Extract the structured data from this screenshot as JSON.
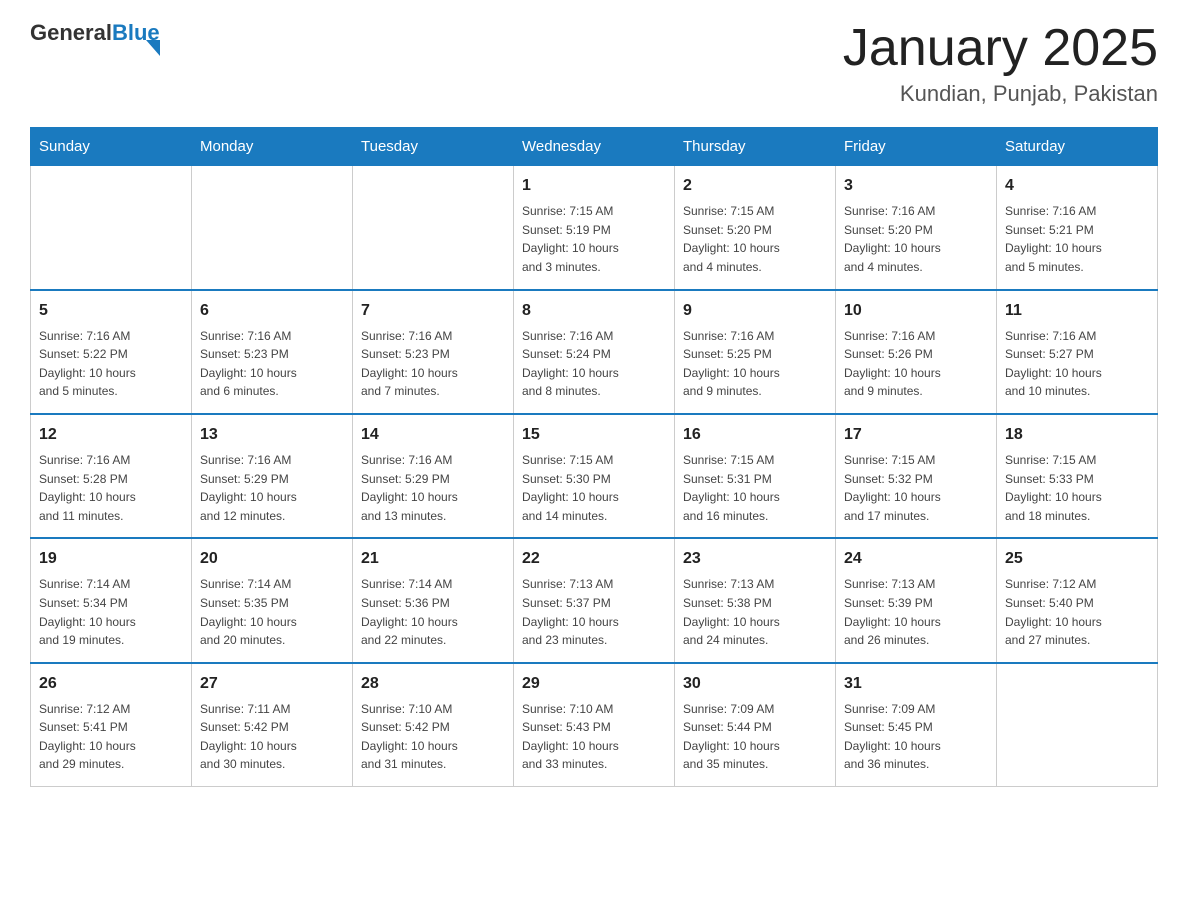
{
  "header": {
    "logo": {
      "general": "General",
      "blue": "Blue"
    },
    "title": "January 2025",
    "subtitle": "Kundian, Punjab, Pakistan"
  },
  "columns": [
    "Sunday",
    "Monday",
    "Tuesday",
    "Wednesday",
    "Thursday",
    "Friday",
    "Saturday"
  ],
  "weeks": [
    [
      {
        "day": "",
        "info": ""
      },
      {
        "day": "",
        "info": ""
      },
      {
        "day": "",
        "info": ""
      },
      {
        "day": "1",
        "info": "Sunrise: 7:15 AM\nSunset: 5:19 PM\nDaylight: 10 hours\nand 3 minutes."
      },
      {
        "day": "2",
        "info": "Sunrise: 7:15 AM\nSunset: 5:20 PM\nDaylight: 10 hours\nand 4 minutes."
      },
      {
        "day": "3",
        "info": "Sunrise: 7:16 AM\nSunset: 5:20 PM\nDaylight: 10 hours\nand 4 minutes."
      },
      {
        "day": "4",
        "info": "Sunrise: 7:16 AM\nSunset: 5:21 PM\nDaylight: 10 hours\nand 5 minutes."
      }
    ],
    [
      {
        "day": "5",
        "info": "Sunrise: 7:16 AM\nSunset: 5:22 PM\nDaylight: 10 hours\nand 5 minutes."
      },
      {
        "day": "6",
        "info": "Sunrise: 7:16 AM\nSunset: 5:23 PM\nDaylight: 10 hours\nand 6 minutes."
      },
      {
        "day": "7",
        "info": "Sunrise: 7:16 AM\nSunset: 5:23 PM\nDaylight: 10 hours\nand 7 minutes."
      },
      {
        "day": "8",
        "info": "Sunrise: 7:16 AM\nSunset: 5:24 PM\nDaylight: 10 hours\nand 8 minutes."
      },
      {
        "day": "9",
        "info": "Sunrise: 7:16 AM\nSunset: 5:25 PM\nDaylight: 10 hours\nand 9 minutes."
      },
      {
        "day": "10",
        "info": "Sunrise: 7:16 AM\nSunset: 5:26 PM\nDaylight: 10 hours\nand 9 minutes."
      },
      {
        "day": "11",
        "info": "Sunrise: 7:16 AM\nSunset: 5:27 PM\nDaylight: 10 hours\nand 10 minutes."
      }
    ],
    [
      {
        "day": "12",
        "info": "Sunrise: 7:16 AM\nSunset: 5:28 PM\nDaylight: 10 hours\nand 11 minutes."
      },
      {
        "day": "13",
        "info": "Sunrise: 7:16 AM\nSunset: 5:29 PM\nDaylight: 10 hours\nand 12 minutes."
      },
      {
        "day": "14",
        "info": "Sunrise: 7:16 AM\nSunset: 5:29 PM\nDaylight: 10 hours\nand 13 minutes."
      },
      {
        "day": "15",
        "info": "Sunrise: 7:15 AM\nSunset: 5:30 PM\nDaylight: 10 hours\nand 14 minutes."
      },
      {
        "day": "16",
        "info": "Sunrise: 7:15 AM\nSunset: 5:31 PM\nDaylight: 10 hours\nand 16 minutes."
      },
      {
        "day": "17",
        "info": "Sunrise: 7:15 AM\nSunset: 5:32 PM\nDaylight: 10 hours\nand 17 minutes."
      },
      {
        "day": "18",
        "info": "Sunrise: 7:15 AM\nSunset: 5:33 PM\nDaylight: 10 hours\nand 18 minutes."
      }
    ],
    [
      {
        "day": "19",
        "info": "Sunrise: 7:14 AM\nSunset: 5:34 PM\nDaylight: 10 hours\nand 19 minutes."
      },
      {
        "day": "20",
        "info": "Sunrise: 7:14 AM\nSunset: 5:35 PM\nDaylight: 10 hours\nand 20 minutes."
      },
      {
        "day": "21",
        "info": "Sunrise: 7:14 AM\nSunset: 5:36 PM\nDaylight: 10 hours\nand 22 minutes."
      },
      {
        "day": "22",
        "info": "Sunrise: 7:13 AM\nSunset: 5:37 PM\nDaylight: 10 hours\nand 23 minutes."
      },
      {
        "day": "23",
        "info": "Sunrise: 7:13 AM\nSunset: 5:38 PM\nDaylight: 10 hours\nand 24 minutes."
      },
      {
        "day": "24",
        "info": "Sunrise: 7:13 AM\nSunset: 5:39 PM\nDaylight: 10 hours\nand 26 minutes."
      },
      {
        "day": "25",
        "info": "Sunrise: 7:12 AM\nSunset: 5:40 PM\nDaylight: 10 hours\nand 27 minutes."
      }
    ],
    [
      {
        "day": "26",
        "info": "Sunrise: 7:12 AM\nSunset: 5:41 PM\nDaylight: 10 hours\nand 29 minutes."
      },
      {
        "day": "27",
        "info": "Sunrise: 7:11 AM\nSunset: 5:42 PM\nDaylight: 10 hours\nand 30 minutes."
      },
      {
        "day": "28",
        "info": "Sunrise: 7:10 AM\nSunset: 5:42 PM\nDaylight: 10 hours\nand 31 minutes."
      },
      {
        "day": "29",
        "info": "Sunrise: 7:10 AM\nSunset: 5:43 PM\nDaylight: 10 hours\nand 33 minutes."
      },
      {
        "day": "30",
        "info": "Sunrise: 7:09 AM\nSunset: 5:44 PM\nDaylight: 10 hours\nand 35 minutes."
      },
      {
        "day": "31",
        "info": "Sunrise: 7:09 AM\nSunset: 5:45 PM\nDaylight: 10 hours\nand 36 minutes."
      },
      {
        "day": "",
        "info": ""
      }
    ]
  ]
}
